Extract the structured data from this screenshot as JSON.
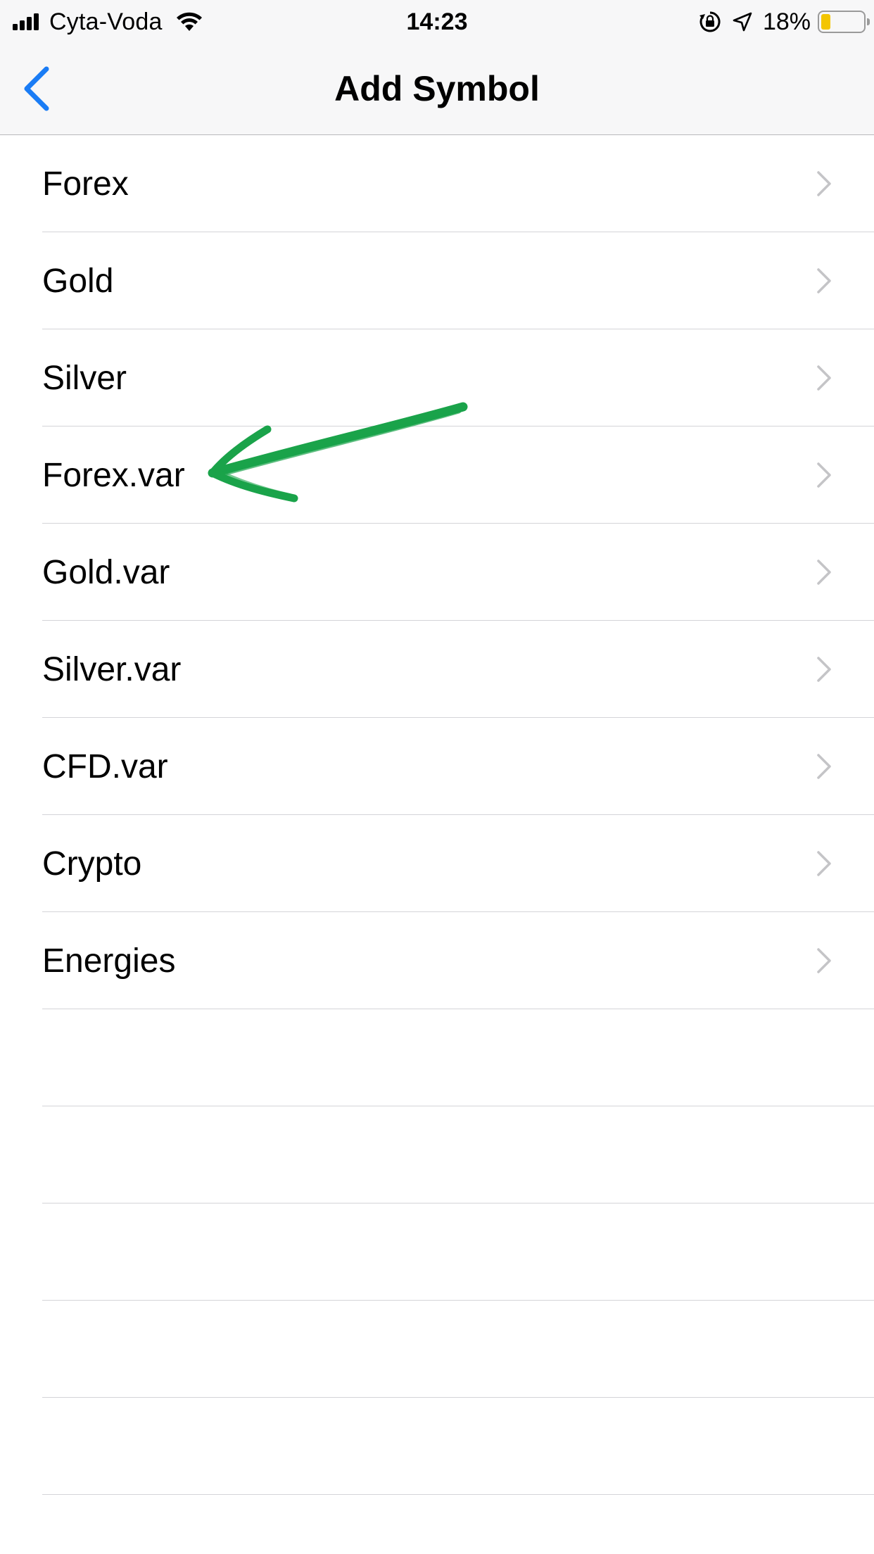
{
  "status_bar": {
    "carrier": "Cyta-Voda",
    "time": "14:23",
    "battery_percent": "18%",
    "battery_level": 0.18,
    "battery_color": "#f3c500",
    "icons": [
      "signal-icon",
      "wifi-icon",
      "orientation-lock-icon",
      "location-arrow-icon",
      "battery-icon"
    ]
  },
  "nav": {
    "title": "Add Symbol",
    "back_icon": "chevron-left-icon",
    "accent_color": "#1a7cf5"
  },
  "list": {
    "items": [
      {
        "label": "Forex"
      },
      {
        "label": "Gold"
      },
      {
        "label": "Silver"
      },
      {
        "label": "Forex.var"
      },
      {
        "label": "Gold.var"
      },
      {
        "label": "Silver.var"
      },
      {
        "label": "CFD.var"
      },
      {
        "label": "Crypto"
      },
      {
        "label": "Energies"
      }
    ],
    "empty_rows": 5,
    "row_icon": "chevron-right-icon"
  },
  "annotation": {
    "icon": "green-arrow-annotation",
    "color": "#1aa34a",
    "points_to": "Forex.var"
  }
}
